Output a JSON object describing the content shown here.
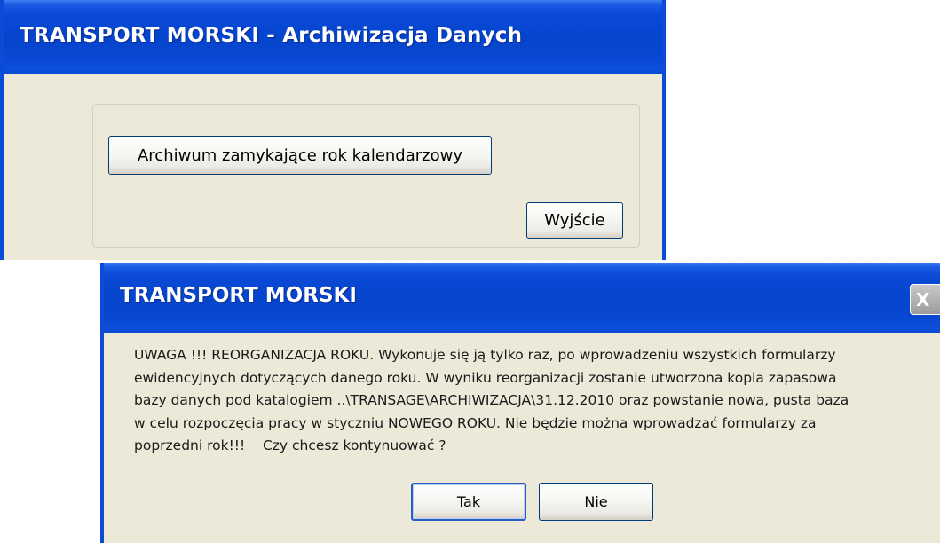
{
  "archive_window": {
    "title": "TRANSPORT MORSKI - Archiwizacja Danych",
    "archive_button_label": "Archiwum zamykające rok kalendarzowy",
    "exit_button_label": "Wyjście"
  },
  "dialog": {
    "title": "TRANSPORT MORSKI",
    "close_glyph": "X",
    "message_lines": [
      "UWAGA !!! REORGANIZACJA ROKU. Wykonuje się ją tylko raz, po wprowadzeniu wszystkich formularzy",
      "ewidencyjnych dotyczących danego roku. W wyniku reorganizacji zostanie utworzona kopia zapasowa",
      "bazy danych pod katalogiem ..\\TRANSAGE\\ARCHIWIZACJA\\31.12.2010 oraz powstanie nowa, pusta baza",
      "w celu rozpoczęcia pracy w styczniu NOWEGO ROKU. Nie będzie można wprowadzać formularzy za",
      "poprzedni rok!!!    Czy chcesz kontynuować ?"
    ],
    "yes_button_label": "Tak",
    "no_button_label": "Nie"
  },
  "colors": {
    "titlebar_blue": "#0544cc",
    "window_face": "#ece9d8",
    "button_border": "#003c74"
  }
}
